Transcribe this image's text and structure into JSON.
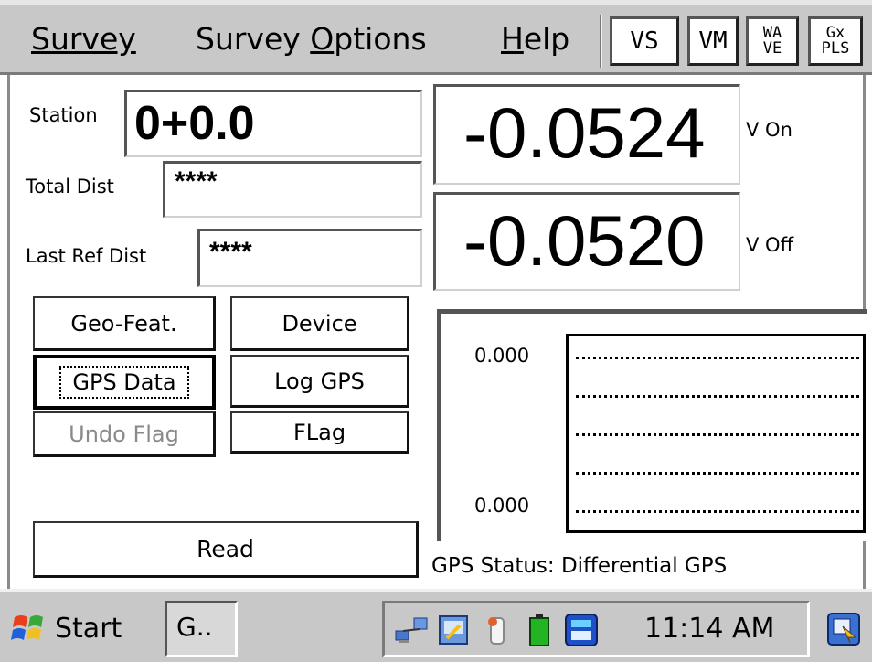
{
  "menu": {
    "survey": "Survey",
    "survey_options_first": "Survey",
    "survey_options_second_ul": "O",
    "survey_options_second_rest": "ptions",
    "help_ul": "H",
    "help_rest": "elp"
  },
  "toolbar": {
    "vs": "VS",
    "vm": "VM",
    "wave_top": "WA",
    "wave_bottom": "VE",
    "gx_top": "Gx",
    "gx_bottom": "PLS"
  },
  "fields": {
    "station_label": "Station",
    "station_value": "0+0.0",
    "total_dist_label": "Total Dist",
    "total_dist_value": "****",
    "last_ref_dist_label": "Last Ref Dist",
    "last_ref_dist_value": "****"
  },
  "readings": {
    "v_on_value": "-0.0524",
    "v_on_label": "V On",
    "v_off_value": "-0.0520",
    "v_off_label": "V Off"
  },
  "buttons": {
    "geo_feat": "Geo-Feat.",
    "device": "Device",
    "gps_data": "GPS Data",
    "log_gps": "Log GPS",
    "undo_flag": "Undo Flag",
    "flag": "FLag",
    "read": "Read"
  },
  "chart_data": {
    "type": "line",
    "yticks": [
      "0.000",
      "0.000"
    ],
    "series": [
      {
        "values": []
      }
    ],
    "grid": true
  },
  "gps_status": "GPS Status: Differential GPS",
  "taskbar": {
    "start": "Start",
    "task": "G..",
    "clock": "11:14 AM"
  },
  "colors": {
    "chrome": "#c8c8c8",
    "background": "#ffffff",
    "disabled_text": "#8a8a8a",
    "battery_green": "#22b422",
    "tray_blue": "#2050c8"
  }
}
